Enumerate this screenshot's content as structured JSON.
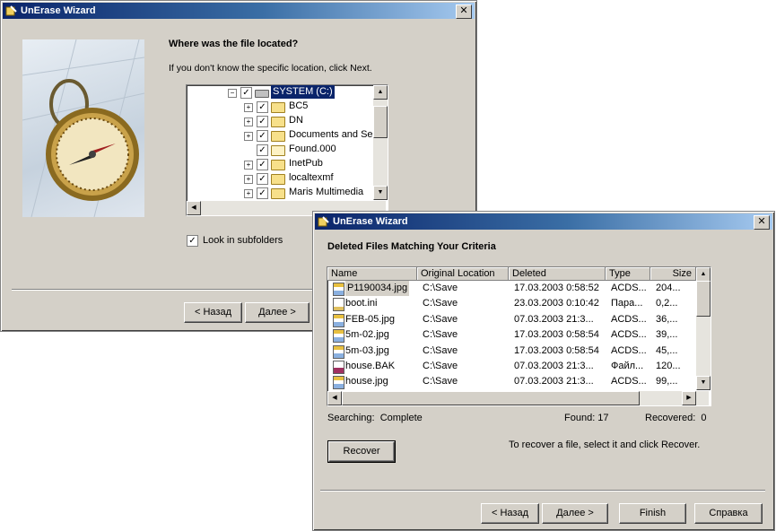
{
  "window1": {
    "title": "UnErase Wizard",
    "heading": "Where was the file located?",
    "instruction": "If you don't know the specific location, click Next.",
    "tree": [
      {
        "label": "SYSTEM (C:)",
        "selected": true,
        "expander": "−",
        "depth": 0
      },
      {
        "label": "BC5",
        "expander": "+",
        "depth": 1
      },
      {
        "label": "DN",
        "expander": "+",
        "depth": 1
      },
      {
        "label": "Documents and Se",
        "expander": "+",
        "depth": 1
      },
      {
        "label": "Found.000",
        "expander": "",
        "depth": 1
      },
      {
        "label": "InetPub",
        "expander": "+",
        "depth": 1
      },
      {
        "label": "localtexmf",
        "expander": "+",
        "depth": 1
      },
      {
        "label": "Maris Multimedia",
        "expander": "+",
        "depth": 1
      }
    ],
    "subfolders_label": "Look in subfolders",
    "subfolders_checked": true,
    "back_button": "< Назад",
    "next_button": "Далее >"
  },
  "window2": {
    "title": "UnErase Wizard",
    "heading": "Deleted Files Matching Your Criteria",
    "columns": [
      "Name",
      "Original Location",
      "Deleted",
      "Type",
      "Size"
    ],
    "rows": [
      {
        "name": "P1190034.jpg",
        "location": "C:\\Save",
        "deleted": "17.03.2003 0:58:52",
        "type": "ACDS...",
        "size": "204...",
        "icon": "jpg-file-icon",
        "selected": true
      },
      {
        "name": "boot.ini",
        "location": "C:\\Save",
        "deleted": "23.03.2003 0:10:42",
        "type": "Пара...",
        "size": "0,2...",
        "icon": "ini-file-icon"
      },
      {
        "name": "FEB-05.jpg",
        "location": "C:\\Save",
        "deleted": "07.03.2003 21:3...",
        "type": "ACDS...",
        "size": "36,...",
        "icon": "jpg-file-icon"
      },
      {
        "name": "5m-02.jpg",
        "location": "C:\\Save",
        "deleted": "17.03.2003 0:58:54",
        "type": "ACDS...",
        "size": "39,...",
        "icon": "jpg-file-icon"
      },
      {
        "name": "5m-03.jpg",
        "location": "C:\\Save",
        "deleted": "17.03.2003 0:58:54",
        "type": "ACDS...",
        "size": "45,...",
        "icon": "jpg-file-icon"
      },
      {
        "name": "house.BAK",
        "location": "C:\\Save",
        "deleted": "07.03.2003 21:3...",
        "type": "Файл...",
        "size": "120...",
        "icon": "bak-file-icon"
      },
      {
        "name": "house.jpg",
        "location": "C:\\Save",
        "deleted": "07.03.2003 21:3...",
        "type": "ACDS...",
        "size": "99,...",
        "icon": "jpg-file-icon"
      }
    ],
    "status_searching": "Searching:  Complete",
    "status_found": "Found: 17",
    "status_recovered": "Recovered:  0",
    "recover_button": "Recover",
    "recover_hint": "To recover a file, select it and click Recover.",
    "back_button": "< Назад",
    "next_button": "Далее >",
    "finish_button": "Finish",
    "help_button": "Справка"
  }
}
